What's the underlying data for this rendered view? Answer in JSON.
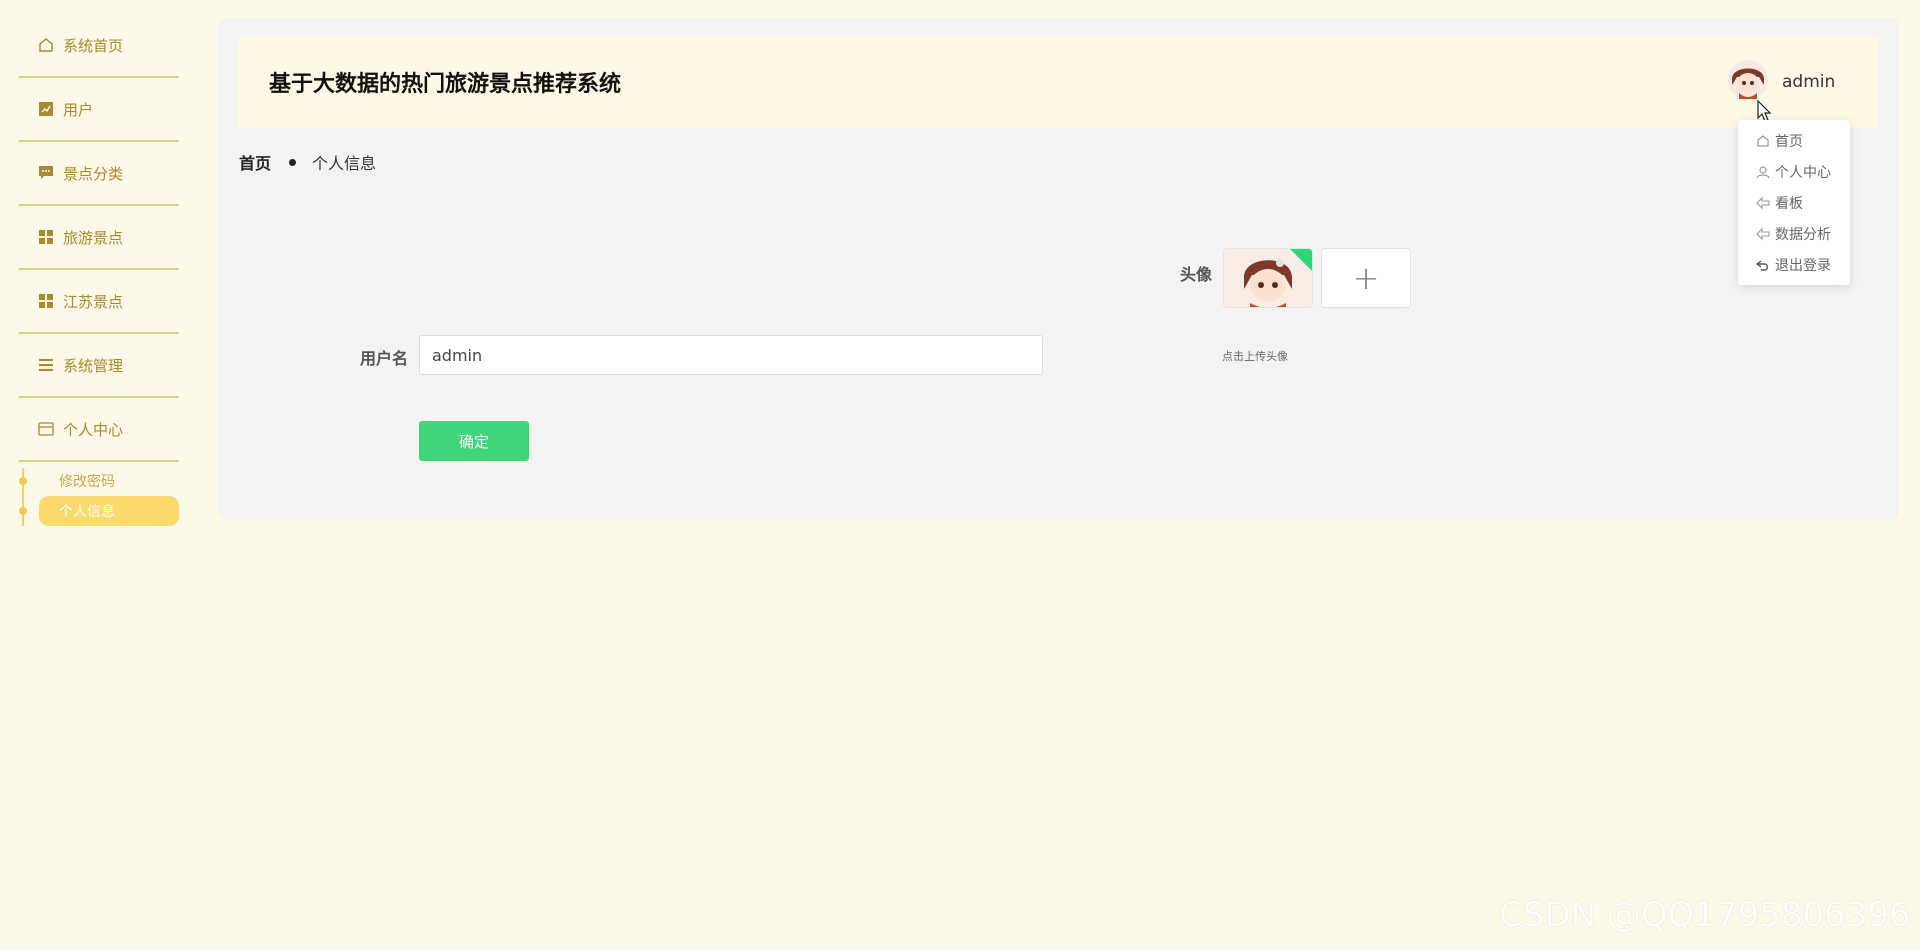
{
  "sidebar": {
    "items": [
      {
        "label": "系统首页",
        "icon": "home-icon"
      },
      {
        "label": "用户",
        "icon": "chart-icon"
      },
      {
        "label": "景点分类",
        "icon": "chat-icon"
      },
      {
        "label": "旅游景点",
        "icon": "grid-icon"
      },
      {
        "label": "江苏景点",
        "icon": "grid-icon"
      },
      {
        "label": "系统管理",
        "icon": "menu-lines-icon"
      },
      {
        "label": "个人中心",
        "icon": "card-icon"
      }
    ],
    "submenu": [
      {
        "label": "修改密码",
        "active": false
      },
      {
        "label": "个人信息",
        "active": true
      }
    ]
  },
  "header": {
    "title": "基于大数据的热门旅游景点推荐系统",
    "username": "admin"
  },
  "breadcrumb": {
    "home": "首页",
    "current": "个人信息"
  },
  "form": {
    "username_label": "用户名",
    "username_value": "admin",
    "avatar_label": "头像",
    "upload_plus": "+",
    "upload_hint": "点击上传头像",
    "confirm_label": "确定"
  },
  "dropdown": {
    "items": [
      {
        "label": "首页",
        "icon": "home-icon"
      },
      {
        "label": "个人中心",
        "icon": "user-icon"
      },
      {
        "label": "看板",
        "icon": "arrow-left-icon"
      },
      {
        "label": "数据分析",
        "icon": "arrow-left-icon"
      },
      {
        "label": "退出登录",
        "icon": "logout-icon"
      }
    ]
  },
  "watermark": "CSDN @QQ1795806396",
  "colors": {
    "background": "#fdf9e8",
    "accent_gold": "#a58a2e",
    "active_yellow": "#fcd968",
    "confirm_green": "#3dd67a"
  }
}
